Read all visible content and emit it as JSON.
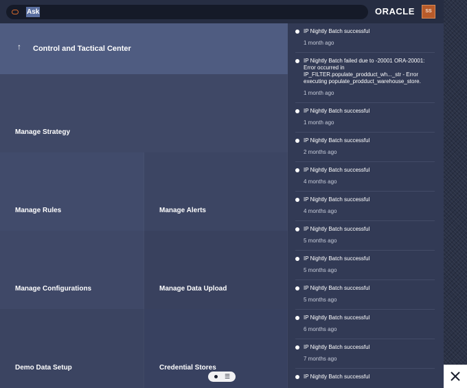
{
  "header": {
    "search_label": "Ask",
    "brand": "ORACLE",
    "avatar_initials": "SS"
  },
  "hero": {
    "arrow": "↑",
    "title": "Control and Tactical Center"
  },
  "tiles": {
    "manage_strategy": "Manage Strategy",
    "manage_rules": "Manage Rules",
    "manage_alerts": "Manage Alerts",
    "manage_configurations": "Manage Configurations",
    "manage_data_upload": "Manage Data Upload",
    "demo_data_setup": "Demo Data Setup",
    "credential_stores": "Credential Stores"
  },
  "feed": [
    {
      "message": "IP Nightly Batch successful",
      "time": "1 month ago"
    },
    {
      "message": "IP Nightly Batch failed due to -20001 ORA-20001: Error occurred in IP_FILTER.populate_prodduct_wh..._str - Error executing populate_prodduct_warehouse_store.",
      "time": "1 month ago"
    },
    {
      "message": "IP Nightly Batch successful",
      "time": "1 month ago"
    },
    {
      "message": "IP Nightly Batch successful",
      "time": "2 months ago"
    },
    {
      "message": "IP Nightly Batch successful",
      "time": "4 months ago"
    },
    {
      "message": "IP Nightly Batch successful",
      "time": "4 months ago"
    },
    {
      "message": "IP Nightly Batch successful",
      "time": "5 months ago"
    },
    {
      "message": "IP Nightly Batch successful",
      "time": "5 months ago"
    },
    {
      "message": "IP Nightly Batch successful",
      "time": "5 months ago"
    },
    {
      "message": "IP Nightly Batch successful",
      "time": "6 months ago"
    },
    {
      "message": "IP Nightly Batch successful",
      "time": "7 months ago"
    },
    {
      "message": "IP Nightly Batch successful",
      "time": ""
    }
  ],
  "colors": {
    "background": "#343c57",
    "topbar": "#262d42",
    "hero_tile": "#4f5c81",
    "feed_panel": "#323a55",
    "brand_accent": "#d66a2c"
  }
}
